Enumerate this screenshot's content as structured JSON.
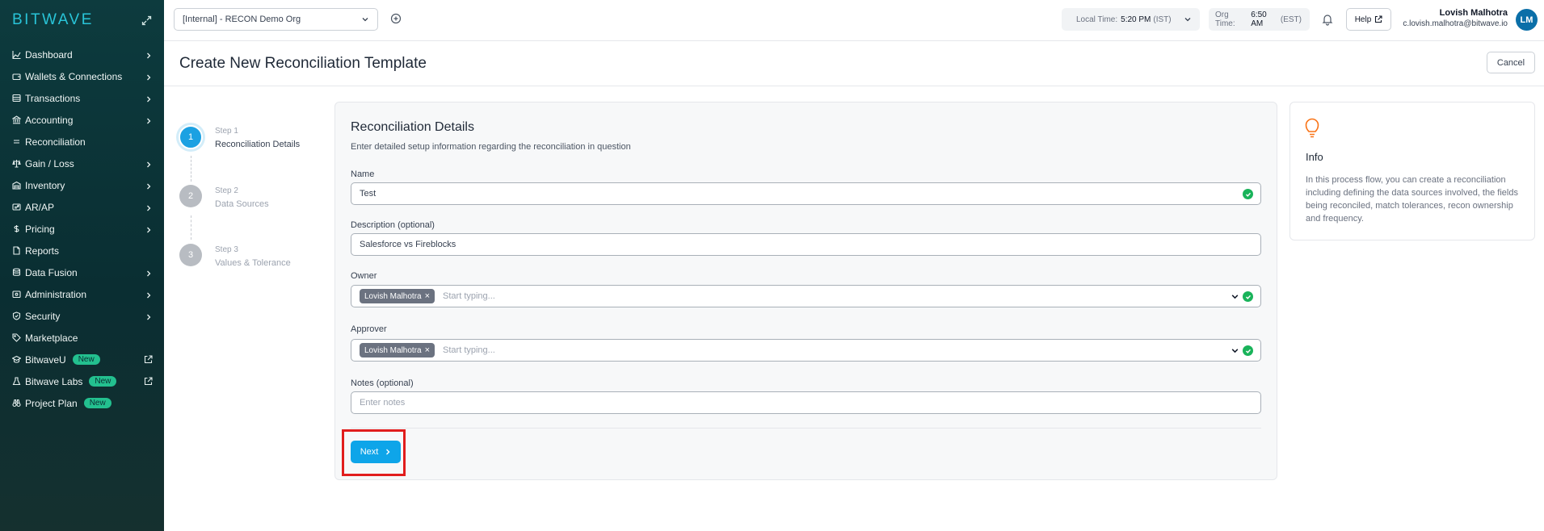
{
  "app": {
    "logo": "BITWAVE"
  },
  "sidebar": {
    "items": [
      {
        "label": "Dashboard",
        "icon": "chart-line-icon",
        "chevron": true
      },
      {
        "label": "Wallets & Connections",
        "icon": "wallet-icon",
        "chevron": true
      },
      {
        "label": "Transactions",
        "icon": "table-icon",
        "chevron": true
      },
      {
        "label": "Accounting",
        "icon": "bank-icon",
        "chevron": true
      },
      {
        "label": "Reconciliation",
        "icon": "equals-icon",
        "chevron": false
      },
      {
        "label": "Gain / Loss",
        "icon": "scale-icon",
        "chevron": true
      },
      {
        "label": "Inventory",
        "icon": "warehouse-icon",
        "chevron": true
      },
      {
        "label": "AR/AP",
        "icon": "invoice-icon",
        "chevron": true
      },
      {
        "label": "Pricing",
        "icon": "dollar-icon",
        "chevron": true
      },
      {
        "label": "Reports",
        "icon": "document-icon",
        "chevron": false
      },
      {
        "label": "Data Fusion",
        "icon": "database-icon",
        "chevron": true
      },
      {
        "label": "Administration",
        "icon": "admin-icon",
        "chevron": true
      },
      {
        "label": "Security",
        "icon": "shield-icon",
        "chevron": true
      },
      {
        "label": "Marketplace",
        "icon": "tag-icon",
        "chevron": false
      },
      {
        "label": "BitwaveU",
        "icon": "graduation-cap-icon",
        "badge": "New",
        "external": true
      },
      {
        "label": "Bitwave Labs",
        "icon": "flask-icon",
        "badge": "New",
        "external": true
      },
      {
        "label": "Project Plan",
        "icon": "binoculars-icon",
        "badge": "New",
        "external": false
      }
    ]
  },
  "topbar": {
    "org_select": "[Internal] - RECON Demo Org",
    "local_time_label": "Local Time:",
    "local_time_value": "5:20 PM",
    "local_time_zone": "(IST)",
    "org_time_label": "Org Time:",
    "org_time_value": "6:50 AM",
    "org_time_zone": "(EST)",
    "help_label": "Help",
    "user_name": "Lovish Malhotra",
    "user_email": "c.lovish.malhotra@bitwave.io",
    "avatar_initials": "LM"
  },
  "page": {
    "title": "Create New Reconciliation Template",
    "cancel_label": "Cancel"
  },
  "steps": [
    {
      "num": "1",
      "step_label": "Step 1",
      "title": "Reconciliation Details",
      "state": "active"
    },
    {
      "num": "2",
      "step_label": "Step 2",
      "title": "Data Sources",
      "state": "pending"
    },
    {
      "num": "3",
      "step_label": "Step 3",
      "title": "Values & Tolerance",
      "state": "pending"
    }
  ],
  "form": {
    "title": "Reconciliation Details",
    "subtitle": "Enter detailed setup information regarding the reconciliation in question",
    "name_label": "Name",
    "name_value": "Test",
    "description_label": "Description (optional)",
    "description_value": "Salesforce vs Fireblocks",
    "owner_label": "Owner",
    "owner_chip": "Lovish Malhotra",
    "owner_placeholder": "Start typing...",
    "approver_label": "Approver",
    "approver_chip": "Lovish Malhotra",
    "approver_placeholder": "Start typing...",
    "notes_label": "Notes (optional)",
    "notes_placeholder": "Enter notes",
    "next_label": "Next"
  },
  "info": {
    "title": "Info",
    "text": "In this process flow, you can create a reconciliation including defining the data sources involved, the fields being reconciled, match tolerances, recon ownership and frequency."
  },
  "colors": {
    "accent": "#0ea5e9",
    "sidebar_bg": "#0d3b3e",
    "success": "#19b35a",
    "highlight": "#e11d1d"
  }
}
